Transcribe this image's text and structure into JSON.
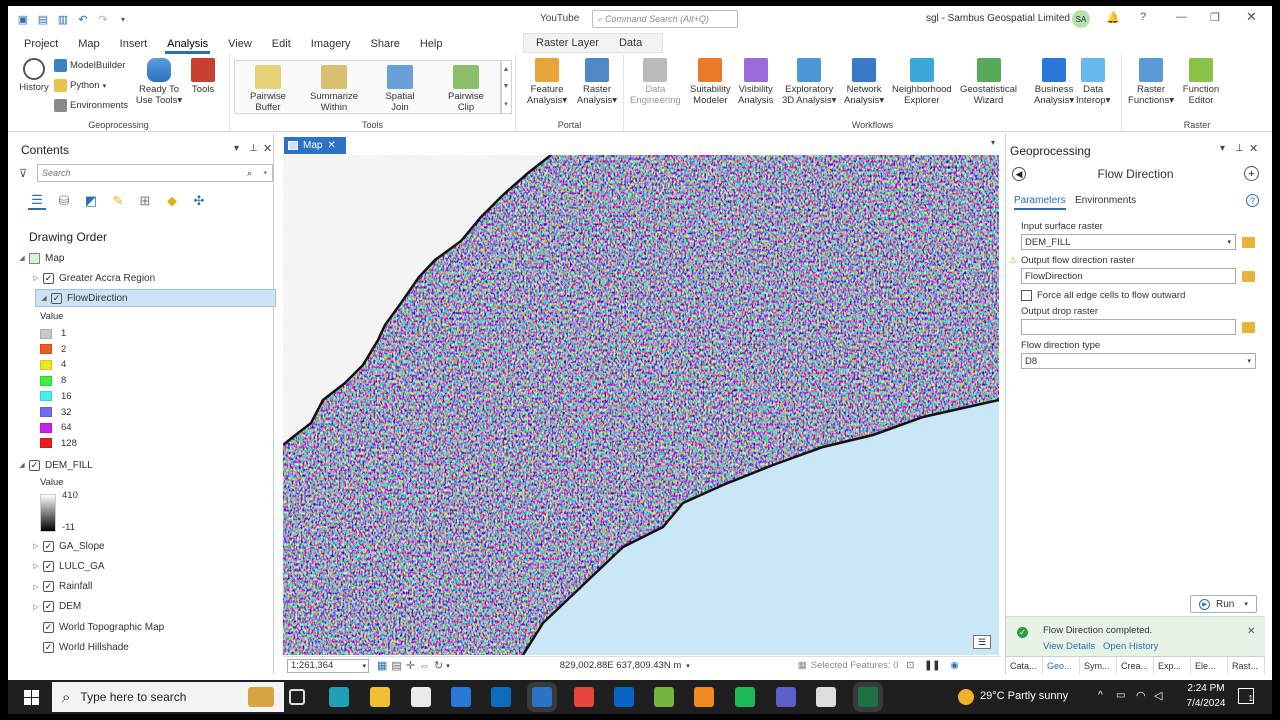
{
  "titlebar": {
    "center_app": "YouTube",
    "command_search_placeholder": "Command Search (Alt+Q)",
    "account": "sgl - Sambus Geospatial Limited",
    "avatar_initials": "SA",
    "help": "?"
  },
  "tabs": [
    "Project",
    "Map",
    "Insert",
    "Analysis",
    "View",
    "Edit",
    "Imagery",
    "Share",
    "Help"
  ],
  "active_tab": "Analysis",
  "context_tabs": [
    "Raster Layer",
    "Data"
  ],
  "ribbon": {
    "geoprocessing": {
      "label": "Geoprocessing",
      "history": "History",
      "modelbuilder": "ModelBuilder",
      "python": "Python",
      "environments": "Environments",
      "ready_to_use_1": "Ready To",
      "ready_to_use_2": "Use Tools",
      "tools": "Tools"
    },
    "tools_group": {
      "label": "Tools",
      "items": [
        {
          "l1": "Pairwise",
          "l2": "Buffer"
        },
        {
          "l1": "Summarize",
          "l2": "Within"
        },
        {
          "l1": "Spatial",
          "l2": "Join"
        },
        {
          "l1": "Pairwise",
          "l2": "Clip"
        }
      ]
    },
    "portal": {
      "label": "Portal",
      "feature_1": "Feature",
      "feature_2": "Analysis",
      "raster_1": "Raster",
      "raster_2": "Analysis"
    },
    "workflows": {
      "label": "Workflows",
      "items": [
        {
          "l1": "Data",
          "l2": "Engineering",
          "dim": true
        },
        {
          "l1": "Suitability",
          "l2": "Modeler"
        },
        {
          "l1": "Visibility",
          "l2": "Analysis"
        },
        {
          "l1": "Exploratory",
          "l2": "3D Analysis"
        },
        {
          "l1": "Network",
          "l2": "Analysis"
        },
        {
          "l1": "Neighborhood",
          "l2": "Explorer"
        },
        {
          "l1": "Geostatistical",
          "l2": "Wizard"
        },
        {
          "l1": "Business",
          "l2": "Analysis"
        },
        {
          "l1": "Data",
          "l2": "Interop"
        }
      ]
    },
    "raster": {
      "label": "Raster",
      "fn_1": "Raster",
      "fn_2": "Functions",
      "ed_1": "Function",
      "ed_2": "Editor"
    }
  },
  "contents": {
    "title": "Contents",
    "search_placeholder": "Search",
    "drawing_order": "Drawing Order",
    "map_node": "Map",
    "layers_top": [
      "Greater Accra Region",
      "FlowDirection"
    ],
    "value_label": "Value",
    "legend": [
      {
        "v": "1",
        "c": "#c8c8c8"
      },
      {
        "v": "2",
        "c": "#f05a1e"
      },
      {
        "v": "4",
        "c": "#f0e61e"
      },
      {
        "v": "8",
        "c": "#3cf03c"
      },
      {
        "v": "16",
        "c": "#46f0f0"
      },
      {
        "v": "32",
        "c": "#6e6ef0"
      },
      {
        "v": "64",
        "c": "#c81ef0"
      },
      {
        "v": "128",
        "c": "#e61e1e"
      }
    ],
    "dem_fill": "DEM_FILL",
    "dem_value_label": "Value",
    "dem_max": "410",
    "dem_min": "-11",
    "layers_bottom": [
      "GA_Slope",
      "LULC_GA",
      "Rainfall",
      "DEM",
      "World Topographic Map",
      "World Hillshade"
    ]
  },
  "map": {
    "tab_label": "Map",
    "scale": "1:261,364",
    "coords": "829,002.88E 637,809.43N m",
    "selected_features": "Selected Features: 0"
  },
  "geoprocessing": {
    "panel_title": "Geoprocessing",
    "tool_title": "Flow Direction",
    "tab_parameters": "Parameters",
    "tab_environments": "Environments",
    "input_label": "Input surface raster",
    "input_value": "DEM_FILL",
    "output_label": "Output flow direction raster",
    "output_value": "FlowDirection",
    "force_label": "Force all edge cells to flow outward",
    "drop_label": "Output drop raster",
    "drop_value": "",
    "type_label": "Flow direction type",
    "type_value": "D8",
    "run": "Run",
    "completed": "Flow Direction completed.",
    "view_details": "View Details",
    "open_history": "Open History",
    "bottom_tabs": [
      "Cata...",
      "Geo...",
      "Sym...",
      "Crea...",
      "Exp...",
      "Ele...",
      "Rast..."
    ]
  },
  "taskbar": {
    "search": "Type here to search",
    "weather": "29°C  Partly sunny",
    "time": "2:24 PM",
    "date": "7/4/2024",
    "notifications": "1"
  }
}
